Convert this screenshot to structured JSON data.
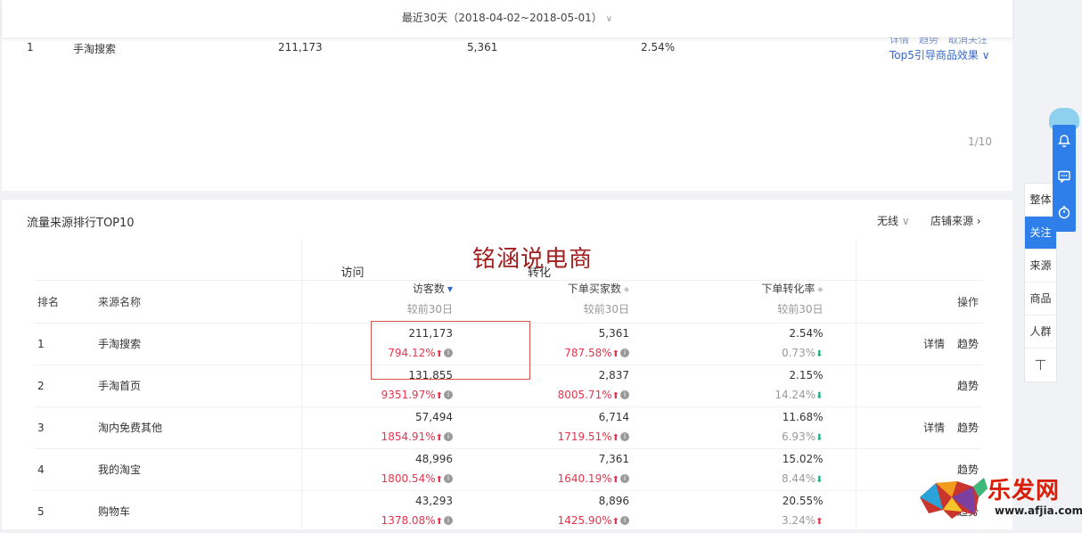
{
  "date_filter": {
    "label": "最近30天（2018-04-02~2018-05-01）"
  },
  "top_table_row": {
    "rank": "1",
    "source": "手淘搜索",
    "visitors": "211,173",
    "buyers": "5,361",
    "rate": "2.54%"
  },
  "top_actions": {
    "line1": "详情　趋势　取消关注",
    "top5": "Top5引导商品效果"
  },
  "pager": {
    "text": "1/10"
  },
  "panel": {
    "title": "流量来源排行TOP10",
    "filter": "无线",
    "store_source": "店铺来源",
    "watermark": "铭涵说电商"
  },
  "table": {
    "group_visit": "访问",
    "group_convert": "转化",
    "col_rank": "排名",
    "col_source": "来源名称",
    "col_visitors": "访客数",
    "col_buyers": "下单买家数",
    "col_rate": "下单转化率",
    "col_ops": "操作",
    "compare": "较前30日",
    "op_detail": "详情",
    "op_trend": "趋势",
    "rows": [
      {
        "rank": "1",
        "source": "手淘搜索",
        "visitors": "211,173",
        "visitors_delta": "794.12%",
        "buyers": "5,361",
        "buyers_delta": "787.58%",
        "rate": "2.54%",
        "rate_delta": "0.73%",
        "rate_dir": "down",
        "detail": true
      },
      {
        "rank": "2",
        "source": "手淘首页",
        "visitors": "131,855",
        "visitors_delta": "9351.97%",
        "buyers": "2,837",
        "buyers_delta": "8005.71%",
        "rate": "2.15%",
        "rate_delta": "14.24%",
        "rate_dir": "down",
        "detail": false
      },
      {
        "rank": "3",
        "source": "淘内免费其他",
        "visitors": "57,494",
        "visitors_delta": "1854.91%",
        "buyers": "6,714",
        "buyers_delta": "1719.51%",
        "rate": "11.68%",
        "rate_delta": "6.93%",
        "rate_dir": "down",
        "detail": true
      },
      {
        "rank": "4",
        "source": "我的淘宝",
        "visitors": "48,996",
        "visitors_delta": "1800.54%",
        "buyers": "7,361",
        "buyers_delta": "1640.19%",
        "rate": "15.02%",
        "rate_delta": "8.44%",
        "rate_dir": "down",
        "detail": false
      },
      {
        "rank": "5",
        "source": "购物车",
        "visitors": "43,293",
        "visitors_delta": "1378.08%",
        "buyers": "8,896",
        "buyers_delta": "1425.90%",
        "rate": "20.55%",
        "rate_delta": "3.24%",
        "rate_dir": "up",
        "detail": false
      }
    ]
  },
  "side_nav": {
    "items": [
      "整体",
      "关注",
      "来源",
      "商品",
      "人群"
    ],
    "active": "关注",
    "up": "⼁"
  },
  "logo": {
    "brand": "乐发网",
    "url": "www.afjia.com"
  },
  "colors": {
    "accent": "#2f7fea",
    "link": "#3467c8",
    "up": "#e5344b",
    "down": "#17b07f"
  }
}
